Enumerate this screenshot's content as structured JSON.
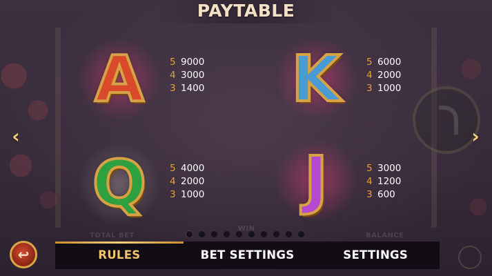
{
  "title": "PAYTABLE",
  "nav": {
    "prev_icon": "chevron-left-icon",
    "next_icon": "chevron-right-icon",
    "prev": "‹",
    "next": "›"
  },
  "symbols": [
    {
      "id": "A",
      "letter": "A",
      "color": "#d94a2b",
      "pays": [
        {
          "count": "5",
          "value": "9000"
        },
        {
          "count": "4",
          "value": "3000"
        },
        {
          "count": "3",
          "value": "1400"
        }
      ]
    },
    {
      "id": "K",
      "letter": "K",
      "color": "#4a9ad6",
      "pays": [
        {
          "count": "5",
          "value": "6000"
        },
        {
          "count": "4",
          "value": "2000"
        },
        {
          "count": "3",
          "value": "1000"
        }
      ]
    },
    {
      "id": "Q",
      "letter": "Q",
      "color": "#2fa040",
      "pays": [
        {
          "count": "5",
          "value": "4000"
        },
        {
          "count": "4",
          "value": "2000"
        },
        {
          "count": "3",
          "value": "1000"
        }
      ]
    },
    {
      "id": "J",
      "letter": "J",
      "color": "#b54ad0",
      "pays": [
        {
          "count": "5",
          "value": "3000"
        },
        {
          "count": "4",
          "value": "1200"
        },
        {
          "count": "3",
          "value": "600"
        }
      ]
    }
  ],
  "pagination": {
    "total": 10,
    "active": 0
  },
  "background_labels": {
    "total_bet": "TOTAL BET",
    "win": "WIN",
    "balance": "BALANCE"
  },
  "back_button": {
    "icon": "back-arrow-icon",
    "glyph": "↩"
  },
  "tabs": [
    {
      "label": "RULES",
      "active": true
    },
    {
      "label": "BET SETTINGS",
      "active": false
    },
    {
      "label": "SETTINGS",
      "active": false
    }
  ],
  "colors": {
    "accent": "#f1c46a",
    "pay_count": "#e5a237",
    "tab_bar": "#120d14"
  }
}
